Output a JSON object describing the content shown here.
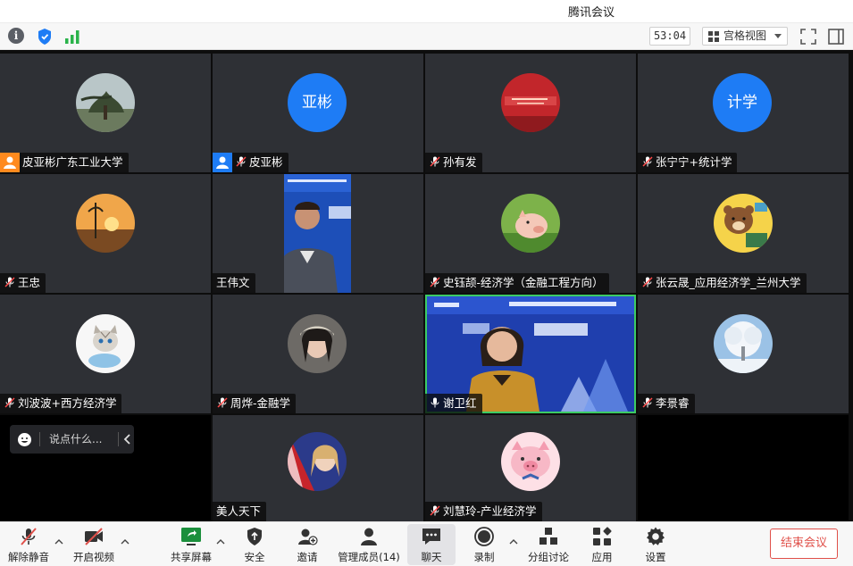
{
  "window": {
    "title": "腾讯会议"
  },
  "infobar": {
    "timer": "53:04",
    "view_label": "宫格视图",
    "icons": [
      "info-icon",
      "security-shield-icon",
      "signal-strength-icon",
      "fullscreen-icon",
      "side-panel-icon"
    ]
  },
  "participants": [
    {
      "name": "皮亚彬广东工业大学",
      "avatar_type": "photo-tree",
      "mic": "host-user"
    },
    {
      "name": "皮亚彬",
      "avatar_text": "亚彬",
      "avatar_color": "#1e7cf5",
      "mic": "muted",
      "badge": "host-user"
    },
    {
      "name": "孙有发",
      "avatar_type": "photo-book",
      "mic": "muted"
    },
    {
      "name": "张宁宁+统计学",
      "avatar_text": "计学",
      "avatar_color": "#1e7cf5",
      "mic": "muted"
    },
    {
      "name": "王忠",
      "avatar_type": "photo-sunset",
      "mic": "muted"
    },
    {
      "name": "王伟文",
      "avatar_type": "video",
      "mic": "none"
    },
    {
      "name": "史钰颉-经济学（金融工程方向）",
      "avatar_type": "photo-piglet",
      "mic": "muted"
    },
    {
      "name": "张云晟_应用经济学_兰州大学",
      "avatar_type": "photo-bear",
      "mic": "muted"
    },
    {
      "name": "刘波波+西方经济学",
      "avatar_type": "photo-kitten",
      "mic": "muted"
    },
    {
      "name": "周烨-金融学",
      "avatar_type": "photo-girl",
      "mic": "muted"
    },
    {
      "name": "谢卫红",
      "avatar_type": "video",
      "mic": "active"
    },
    {
      "name": "李景睿",
      "avatar_type": "photo-frost-tree",
      "mic": "muted"
    },
    {
      "name": "美人天下",
      "avatar_type": "photo-flag-girl",
      "mic": "muted"
    },
    {
      "name": "刘慧玲-产业经济学",
      "avatar_type": "photo-pig-cartoon",
      "mic": "muted"
    }
  ],
  "chat": {
    "placeholder": "说点什么..."
  },
  "toolbar": {
    "unmute": "解除静音",
    "video": "开启视频",
    "share": "共享屏幕",
    "security": "安全",
    "invite": "邀请",
    "members": "管理成员(14)",
    "chat": "聊天",
    "record": "录制",
    "breakout": "分组讨论",
    "apps": "应用",
    "settings": "设置",
    "end": "结束会议"
  },
  "colors": {
    "accent_blue": "#1e7cf5",
    "end_red": "#e0504a",
    "speaking_green": "#3ccb64",
    "tile_bg": "#2e3035"
  }
}
